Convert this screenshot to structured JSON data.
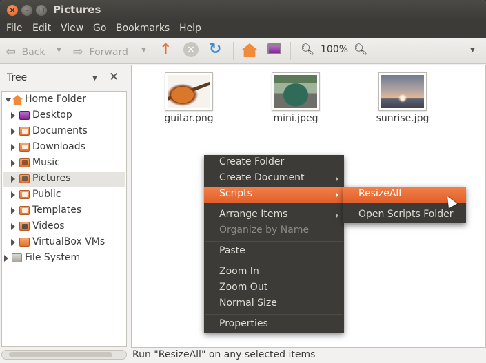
{
  "window": {
    "title": "Pictures"
  },
  "menubar": [
    "File",
    "Edit",
    "View",
    "Go",
    "Bookmarks",
    "Help"
  ],
  "toolbar": {
    "back_label": "Back",
    "forward_label": "Forward",
    "zoom_level": "100%"
  },
  "sidebar": {
    "header": "Tree",
    "items": [
      {
        "label": "Home Folder",
        "icon": "home-icon"
      },
      {
        "label": "Desktop",
        "icon": "desktop-folder-icon"
      },
      {
        "label": "Documents",
        "icon": "documents-folder-icon"
      },
      {
        "label": "Downloads",
        "icon": "downloads-folder-icon"
      },
      {
        "label": "Music",
        "icon": "music-folder-icon"
      },
      {
        "label": "Pictures",
        "icon": "pictures-folder-icon"
      },
      {
        "label": "Public",
        "icon": "public-folder-icon"
      },
      {
        "label": "Templates",
        "icon": "templates-folder-icon"
      },
      {
        "label": "Videos",
        "icon": "videos-folder-icon"
      },
      {
        "label": "VirtualBox VMs",
        "icon": "folder-icon"
      },
      {
        "label": "File System",
        "icon": "filesystem-icon"
      }
    ]
  },
  "files": [
    {
      "name": "guitar.png",
      "thumb": "guitar-thumbnail"
    },
    {
      "name": "mini.jpeg",
      "thumb": "car-thumbnail"
    },
    {
      "name": "sunrise.jpg",
      "thumb": "sunrise-thumbnail"
    }
  ],
  "context_menu": {
    "items": [
      {
        "label": "Create Folder"
      },
      {
        "label": "Create Document"
      },
      {
        "label": "Scripts"
      },
      {
        "label": "Arrange Items"
      },
      {
        "label": "Organize by Name"
      },
      {
        "label": "Paste"
      },
      {
        "label": "Zoom In"
      },
      {
        "label": "Zoom Out"
      },
      {
        "label": "Normal Size"
      },
      {
        "label": "Properties"
      }
    ]
  },
  "scripts_submenu": {
    "items": [
      {
        "label": "ResizeAll"
      },
      {
        "label": "Open Scripts Folder"
      }
    ]
  },
  "statusbar": {
    "text": "Run \"ResizeAll\" on any selected items"
  },
  "colors": {
    "accent": "#e9743a",
    "titlebar": "#3c3b37",
    "menu_bg": "#3c3b37"
  }
}
